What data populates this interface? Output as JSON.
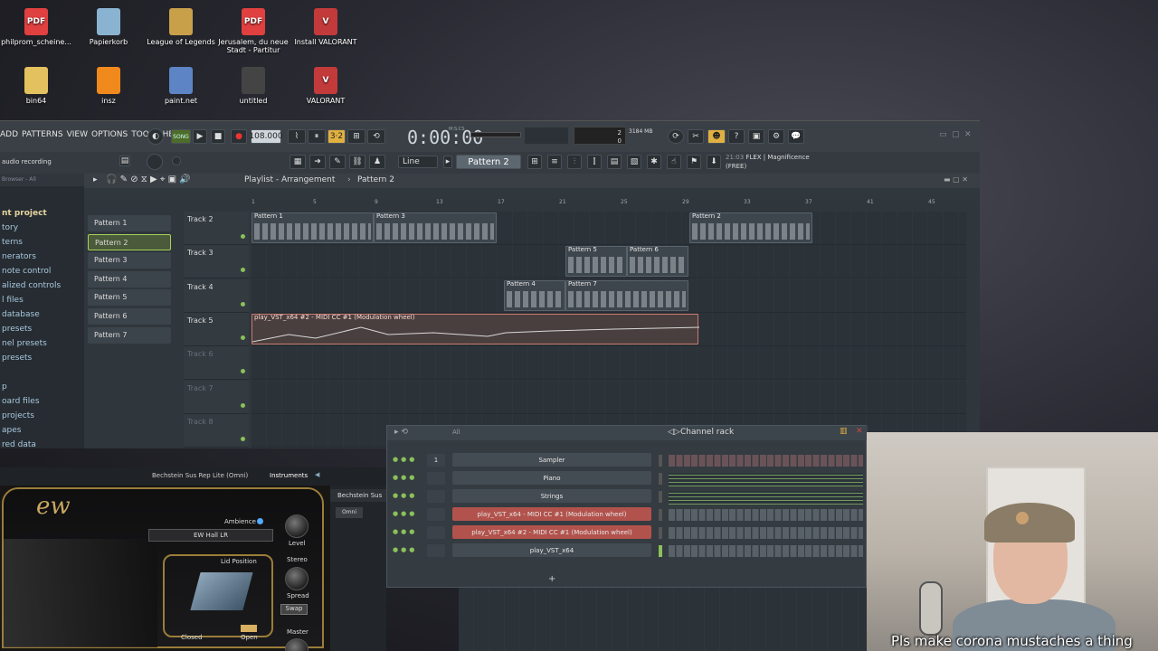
{
  "desktop": {
    "icons": [
      {
        "label": "philprom_scheine...",
        "kind": "PDF",
        "color": "#e04040"
      },
      {
        "label": "Papierkorb",
        "kind": "",
        "color": "#8ab3d1"
      },
      {
        "label": "League of Legends",
        "kind": "",
        "color": "#c8a04a"
      },
      {
        "label": "Jerusalem, du neue Stadt - Partitur",
        "kind": "PDF",
        "color": "#e04040"
      },
      {
        "label": "Install VALORANT",
        "kind": "V",
        "color": "#c23a3a"
      },
      {
        "label": "bin64",
        "kind": "",
        "color": "#e3c15e"
      },
      {
        "label": "insz",
        "kind": "",
        "color": "#f08a1c"
      },
      {
        "label": "paint.net",
        "kind": "",
        "color": "#5d84c5"
      },
      {
        "label": "untitled",
        "kind": "",
        "color": "#444"
      },
      {
        "label": "VALORANT",
        "kind": "V",
        "color": "#c23a3a"
      }
    ]
  },
  "fl": {
    "menu": [
      "ADD",
      "PATTERNS",
      "VIEW",
      "OPTIONS",
      "TOOLS",
      "HELP"
    ],
    "song_mode": "SONG",
    "tempo": "108.000",
    "time": "0:00:00",
    "time_label": "M:S:CS",
    "cpu": "2",
    "memory": "3184 MB",
    "poly": "0",
    "status": "audio recording",
    "snap": "Line",
    "pattern_selector": "Pattern 2",
    "news_time": "21:03",
    "news_text": "FLEX | Magnificence",
    "news_sub": "(FREE)",
    "browser_label": "Browser - All",
    "browser_items": [
      "nt project",
      "tory",
      "terns",
      "nerators",
      "note control",
      "alized controls",
      "l files",
      " database",
      " presets",
      "nel presets",
      " presets",
      "",
      "p",
      "oard files",
      " projects",
      "apes",
      "red data"
    ]
  },
  "playlist": {
    "title": "Playlist - Arrangement",
    "current": "Pattern 2",
    "patterns": [
      "Pattern 1",
      "Pattern 2",
      "Pattern 3",
      "Pattern 4",
      "Pattern 5",
      "Pattern 6",
      "Pattern 7"
    ],
    "ruler": [
      "1",
      "5",
      "9",
      "13",
      "17",
      "21",
      "25",
      "29",
      "33",
      "37",
      "41",
      "45"
    ],
    "tracks": [
      "Track 2",
      "Track 3",
      "Track 4",
      "Track 5",
      "Track 6",
      "Track 7",
      "Track 8"
    ],
    "clips": {
      "t2a": "Pattern 1",
      "t2b": "Pattern 3",
      "t2c": "Pattern 2",
      "t3a": "Pattern 5",
      "t3b": "Pattern 6",
      "t4a": "Pattern 4",
      "t4b": "Pattern 7",
      "t5": "play_VST_x64 #2 - MIDI CC #1 (Modulation wheel)"
    }
  },
  "channel_rack": {
    "filter": "All",
    "title": "Channel rack",
    "channels": [
      {
        "name": "Sampler",
        "num": "1",
        "style": "normal"
      },
      {
        "name": "Piano",
        "num": "",
        "style": "normal"
      },
      {
        "name": "Strings",
        "num": "",
        "style": "normal"
      },
      {
        "name": "play_VST_x64 - MIDI CC #1 (Modulation wheel)",
        "num": "",
        "style": "red"
      },
      {
        "name": "play_VST_x64 #2 - MIDI CC #1 (Modulation wheel)",
        "num": "",
        "style": "red"
      },
      {
        "name": "play_VST_x64",
        "num": "",
        "style": "normal"
      }
    ],
    "add": "+"
  },
  "plugin": {
    "preset": "Bechstein Sus Rep Lite (Omni)",
    "tab": "Instruments",
    "side_label": "Bechstein Sus",
    "omni": "Omni",
    "brand": "ew",
    "ambience": "Ambience",
    "reverb": "EW Hall LR",
    "level": "Level",
    "lid": "Lid Position",
    "stereo": "Stereo",
    "spread": "Spread",
    "swap": "Swap",
    "closed": "Closed",
    "open": "Open",
    "master": "Master"
  },
  "webcam": {
    "caption": "Pls make corona mustaches a thing"
  }
}
